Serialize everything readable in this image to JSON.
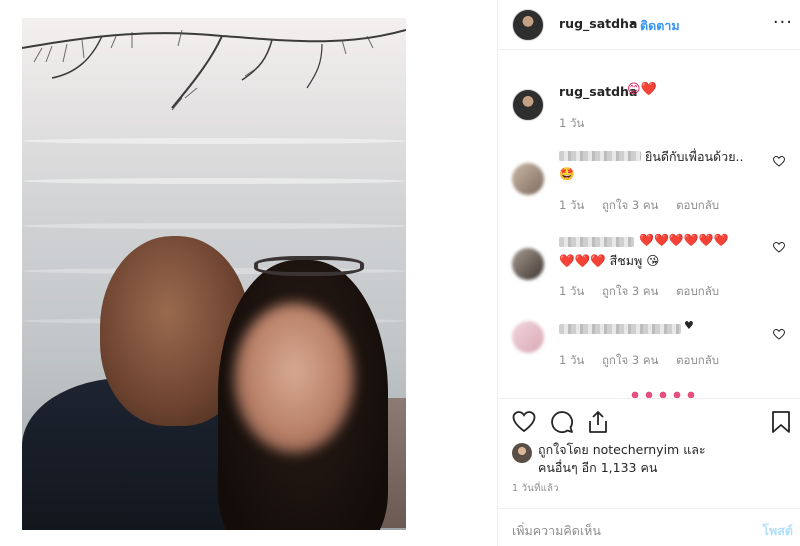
{
  "post": {
    "username": "rug_satdha",
    "follow_separator": "•",
    "follow_label": "ติดตาม",
    "more_label": "···"
  },
  "caption": {
    "username": "rug_satdha",
    "emoji": "😊❤️",
    "time": "1 วัน"
  },
  "comments": [
    {
      "text": "ยินดีกับเพื่อนด้วย..",
      "line2": "🤩",
      "time": "1 วัน",
      "likes": "ถูกใจ 3 คน",
      "reply": "ตอบกลับ"
    },
    {
      "text": "❤️❤️❤️❤️❤️❤️",
      "line2": "❤️❤️❤️ สีชมพู 😘",
      "time": "1 วัน",
      "likes": "ถูกใจ 3 คน",
      "reply": "ตอบกลับ"
    },
    {
      "text": "♥",
      "time": "1 วัน",
      "likes": "ถูกใจ 3 คน",
      "reply": "ตอบกลับ"
    }
  ],
  "likes": {
    "line1": "ถูกใจโดย notechernyim และ",
    "line2": "คนอื่นๆ อีก 1,133 คน"
  },
  "posted_ago": "1 วันที่แล้ว",
  "comment_box": {
    "placeholder": "เพิ่มความคิดเห็น",
    "post_label": "โพสต์"
  },
  "icons": {
    "like": "heart-icon",
    "comment": "comment-icon",
    "share": "share-icon",
    "save": "bookmark-icon"
  },
  "colors": {
    "link": "#3897f0",
    "muted": "#8e8e8e",
    "post_disabled": "#b2dffc"
  }
}
